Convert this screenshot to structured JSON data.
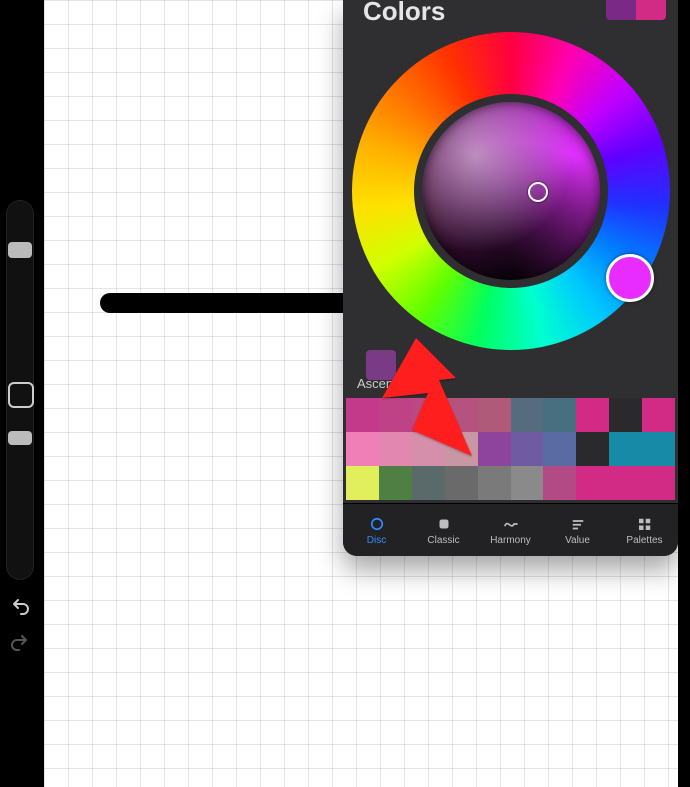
{
  "panel": {
    "title": "Colors",
    "current_color": "#7a2a86",
    "compare_color": "#d12b86",
    "history_swatch": "#7a3a86",
    "palette_name": "Ascend",
    "hue_cursor_color": "#e82cff"
  },
  "palette_colors": [
    "#c43a8a",
    "#c04286",
    "#bb4a82",
    "#b6527e",
    "#b05a7a",
    "#566b7d",
    "#486f80",
    "#d12b86",
    "#2a2a2c",
    "#d12b86",
    "#ef7fb6",
    "#e287b0",
    "#d58faa",
    "#c897a4",
    "#8e449c",
    "#6e5ba2",
    "#5a6aa2",
    "#2a2a2c",
    "#168aa6",
    "#168aa6",
    "#e2ef5d",
    "#4f7f43",
    "#5a6a6a",
    "#6a6a6a",
    "#7a7a7a",
    "#8a8a8a",
    "#b24a86",
    "#d12b86",
    "#d12b86",
    "#d12b86"
  ],
  "tabs": [
    {
      "id": "disc",
      "label": "Disc",
      "active": true
    },
    {
      "id": "classic",
      "label": "Classic",
      "active": false
    },
    {
      "id": "harmony",
      "label": "Harmony",
      "active": false
    },
    {
      "id": "value",
      "label": "Value",
      "active": false
    },
    {
      "id": "palettes",
      "label": "Palettes",
      "active": false
    }
  ],
  "sidebar": {
    "undo_enabled": true,
    "redo_enabled": false
  }
}
